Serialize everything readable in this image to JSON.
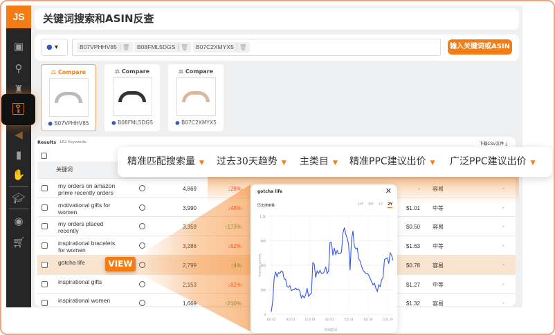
{
  "app": {
    "logo": "JS",
    "title": "关键词搜索和ASIN反查"
  },
  "sidebar": {
    "icons": [
      "briefcase-icon",
      "search-icon",
      "castle-icon",
      "key-icon",
      "megaphone-icon",
      "bar-chart-icon",
      "hand-icon",
      "graduation-cap-icon",
      "aperture-icon",
      "cart-icon"
    ],
    "active": "key-icon"
  },
  "search": {
    "country": "US",
    "chips": [
      "B07VPHHV85",
      "B08FML5DGS",
      "B07C2XMYX5"
    ],
    "button": "输入关键词或ASIN"
  },
  "products": [
    {
      "compare": "Compare",
      "asin": "B07VPHHV85",
      "selected": true
    },
    {
      "compare": "Compare",
      "asin": "B08FML5DGS",
      "selected": false
    },
    {
      "compare": "Compare",
      "asin": "B07C2XMYX5",
      "selected": false
    }
  ],
  "results": {
    "label": "Results",
    "count": "162 Keywords",
    "download": "下载CSV文件",
    "keyword_header": "关键词",
    "columns": [
      "精准匹配搜索量",
      "过去30天趋势",
      "主类目",
      "精准PPC建议出价",
      "广泛PPC建议出价"
    ],
    "rows": [
      {
        "keyword": "my orders on amazon prime recently orders",
        "volume": "4,869",
        "trend": "↓28%",
        "up": false,
        "price": "-",
        "difficulty": "容易",
        "extra": "-"
      },
      {
        "keyword": "motivational gifts for women",
        "volume": "3,990",
        "trend": "↓48%",
        "up": false,
        "price": "$1.01",
        "difficulty": "中等",
        "extra": "-"
      },
      {
        "keyword": "my orders placed recently",
        "volume": "3,359",
        "trend": "↑173%",
        "up": true,
        "price": "$0.50",
        "difficulty": "容易",
        "extra": "-"
      },
      {
        "keyword": "inspirational bracelets for women",
        "volume": "3,286",
        "trend": "↓62%",
        "up": false,
        "price": "$1.63",
        "difficulty": "中等",
        "extra": "-"
      },
      {
        "keyword": "gotcha life",
        "volume": "2,799",
        "trend": "↑4%",
        "up": true,
        "price": "$0.78",
        "difficulty": "容易",
        "extra": "-",
        "highlight": true
      },
      {
        "keyword": "inspirational gifts",
        "volume": "2,153",
        "trend": "↓82%",
        "up": false,
        "price": "$1.27",
        "difficulty": "中等",
        "extra": "-"
      },
      {
        "keyword": "inspirational women",
        "volume": "1,669",
        "trend": "↑210%",
        "up": true,
        "price": "$1.32",
        "difficulty": "容易",
        "extra": "-"
      }
    ]
  },
  "view_button": "VIEW",
  "popup": {
    "title": "gotcha life",
    "subtitle": "历史搜索量",
    "ranges": [
      "1M",
      "6M",
      "1Y",
      "2Y"
    ],
    "active_range": "2Y"
  },
  "colors": {
    "accent": "#f47c14",
    "up": "#3a9a3a",
    "down": "#e8463a",
    "line": "#3355ee"
  },
  "chart_data": {
    "type": "line",
    "xlabel": "时间区间",
    "ylabel": "Search Volume",
    "ylim": [
      0,
      1200
    ],
    "y_ticks": [
      "0",
      "300",
      "600",
      "900",
      "1.2k"
    ],
    "x_ticks": [
      "6月 02",
      "9月 01",
      "12月 01",
      "3月 01",
      "5月 31",
      "8月 30",
      "11月 29"
    ],
    "grid": true,
    "series": [
      {
        "values": [
          30,
          160,
          440,
          520,
          460,
          510,
          500,
          530,
          520,
          430,
          430,
          340,
          330,
          350,
          290,
          300,
          300,
          320,
          300,
          310,
          280,
          200,
          230,
          200,
          240,
          320,
          220,
          240,
          260,
          630,
          610,
          450,
          530,
          500,
          540,
          500,
          500,
          520,
          580,
          500,
          530,
          880,
          880,
          720,
          810,
          730,
          780,
          740,
          740,
          760,
          990,
          1060,
          980,
          930,
          850,
          540,
          910,
          1020,
          830,
          800,
          810,
          680,
          650,
          590,
          540,
          520,
          500,
          500,
          480,
          440,
          400,
          360,
          380,
          320,
          280,
          360,
          340,
          420,
          450,
          670,
          680,
          690,
          620,
          750,
          720,
          660
        ]
      }
    ]
  }
}
